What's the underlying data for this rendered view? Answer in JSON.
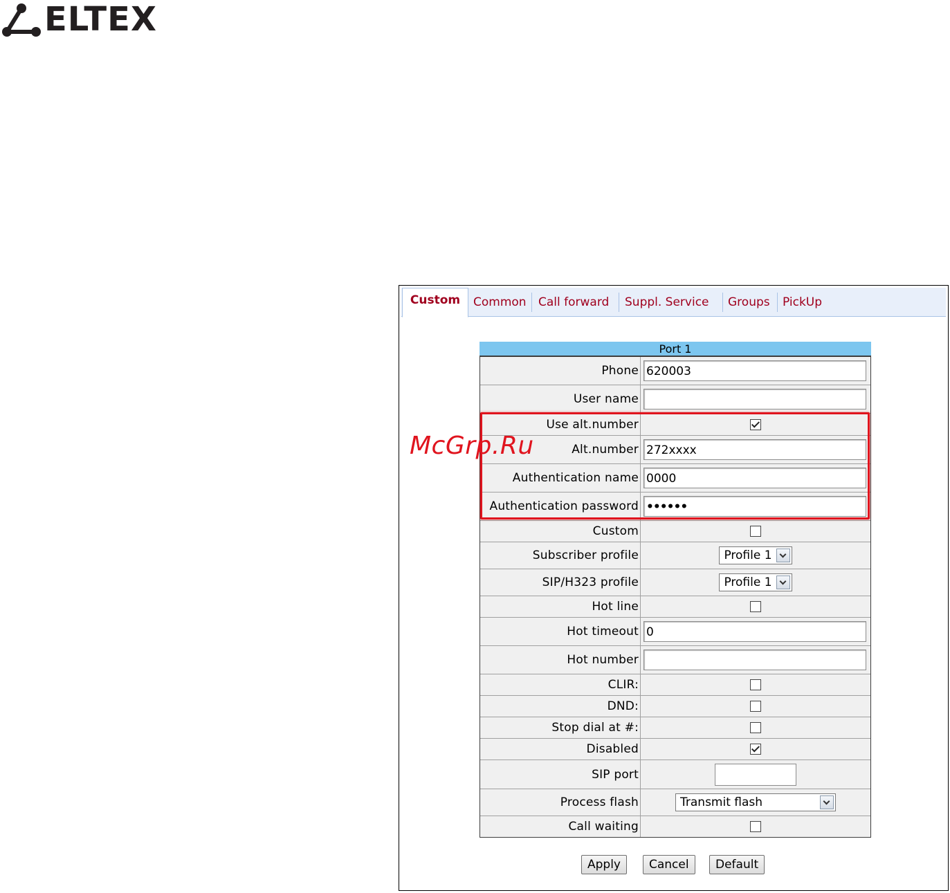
{
  "brand": {
    "logo_text": "ELTEX",
    "logo_color": "#231f20"
  },
  "watermark": {
    "text": "McGrp.Ru",
    "color": "#e0141e"
  },
  "tabs": [
    {
      "label": "Custom",
      "active": true
    },
    {
      "label": "Common",
      "active": false
    },
    {
      "label": "Call forward",
      "active": false
    },
    {
      "label": "Suppl. Service",
      "active": false
    },
    {
      "label": "Groups",
      "active": false
    },
    {
      "label": "PickUp",
      "active": false
    }
  ],
  "form": {
    "title": "Port 1",
    "rows": {
      "phone": {
        "label": "Phone",
        "value": "620003"
      },
      "user_name": {
        "label": "User name",
        "value": ""
      },
      "use_alt_number": {
        "label": "Use alt.number",
        "checked": true
      },
      "alt_number": {
        "label": "Alt.number",
        "value": "272xxxx"
      },
      "auth_name": {
        "label": "Authentication name",
        "value": "0000"
      },
      "auth_password": {
        "label": "Authentication password",
        "value": "••••••"
      },
      "custom": {
        "label": "Custom",
        "checked": false
      },
      "subscriber_profile": {
        "label": "Subscriber profile",
        "selected": "Profile 1"
      },
      "sip_h323_profile": {
        "label": "SIP/H323 profile",
        "selected": "Profile 1"
      },
      "hot_line": {
        "label": "Hot line",
        "checked": false
      },
      "hot_timeout": {
        "label": "Hot timeout",
        "value": "0"
      },
      "hot_number": {
        "label": "Hot number",
        "value": ""
      },
      "clir": {
        "label": "CLIR:",
        "checked": false
      },
      "dnd": {
        "label": "DND:",
        "checked": false
      },
      "stop_dial": {
        "label": "Stop dial at #:",
        "checked": false
      },
      "disabled": {
        "label": "Disabled",
        "checked": true
      },
      "sip_port": {
        "label": "SIP port",
        "value": ""
      },
      "process_flash": {
        "label": "Process flash",
        "selected": "Transmit flash"
      },
      "call_waiting": {
        "label": "Call waiting",
        "checked": false
      }
    }
  },
  "buttons": {
    "apply": "Apply",
    "cancel": "Cancel",
    "default": "Default"
  },
  "colors": {
    "tab_text": "#a0001e",
    "header_bg": "#7dc6ef",
    "tabbar_bg": "#e8effa",
    "highlight": "#e0141e"
  }
}
